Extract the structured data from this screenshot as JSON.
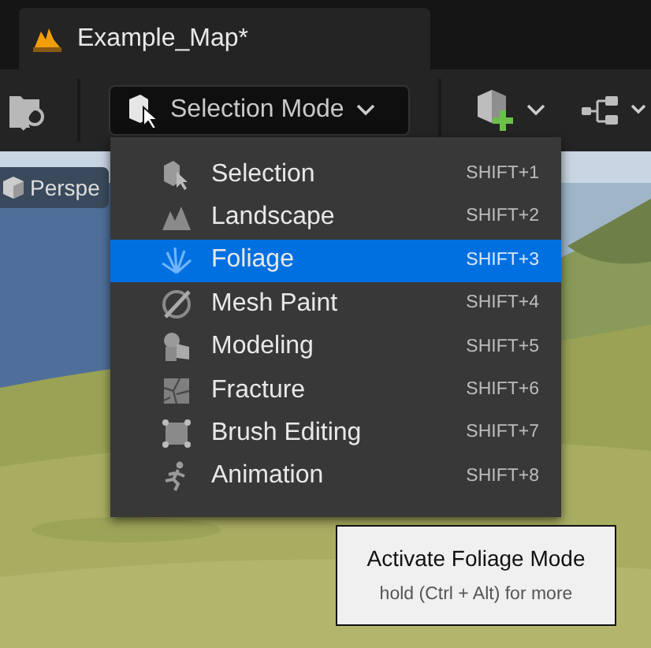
{
  "tab": {
    "title": "Example_Map*"
  },
  "toolbar": {
    "mode_button": {
      "label": "Selection Mode",
      "expanded": true
    }
  },
  "viewport": {
    "view_button": {
      "label": "Perspe"
    }
  },
  "mode_menu": {
    "items": [
      {
        "kind": "selection",
        "label": "Selection",
        "shortcut": "SHIFT+1",
        "selected": false
      },
      {
        "kind": "landscape",
        "label": "Landscape",
        "shortcut": "SHIFT+2",
        "selected": false
      },
      {
        "kind": "foliage",
        "label": "Foliage",
        "shortcut": "SHIFT+3",
        "selected": true
      },
      {
        "kind": "meshpaint",
        "label": "Mesh Paint",
        "shortcut": "SHIFT+4",
        "selected": false
      },
      {
        "kind": "modeling",
        "label": "Modeling",
        "shortcut": "SHIFT+5",
        "selected": false
      },
      {
        "kind": "fracture",
        "label": "Fracture",
        "shortcut": "SHIFT+6",
        "selected": false
      },
      {
        "kind": "brush",
        "label": "Brush Editing",
        "shortcut": "SHIFT+7",
        "selected": false
      },
      {
        "kind": "animation",
        "label": "Animation",
        "shortcut": "SHIFT+8",
        "selected": false
      }
    ]
  },
  "tooltip": {
    "title": "Activate Foliage Mode",
    "hint": "hold (Ctrl + Alt) for more"
  }
}
